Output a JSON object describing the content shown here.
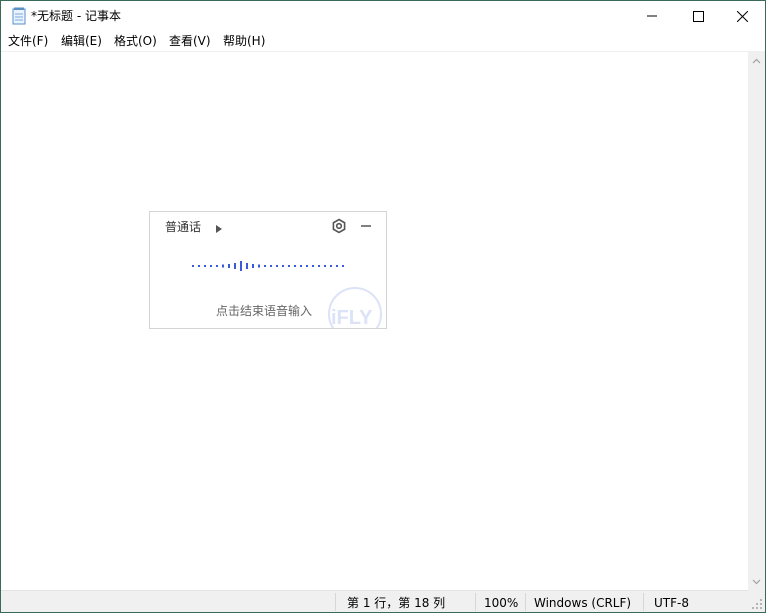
{
  "window": {
    "title": "*无标题 - 记事本",
    "icons": {
      "app": "notepad-icon",
      "minimize": "minimize-icon",
      "maximize": "maximize-icon",
      "close": "close-icon"
    }
  },
  "menubar": {
    "items": [
      {
        "label": "文件(F)"
      },
      {
        "label": "编辑(E)"
      },
      {
        "label": "格式(O)"
      },
      {
        "label": "查看(V)"
      },
      {
        "label": "帮助(H)"
      }
    ]
  },
  "editor": {
    "content": ""
  },
  "statusbar": {
    "position": "第 1 行，第 18 列",
    "zoom": "100%",
    "line_ending": "Windows (CRLF)",
    "encoding": "UTF-8"
  },
  "voice_input": {
    "language": "普通话",
    "hint": "点击结束语音输入",
    "brand": "iFLY",
    "icons": {
      "language_arrow": "triangle-right-icon",
      "settings": "gear-icon",
      "minimize": "minus-icon"
    },
    "colors": {
      "wave": "#3b5bdb",
      "brand": "#dce3f6",
      "border": "#d4d4d4"
    }
  }
}
